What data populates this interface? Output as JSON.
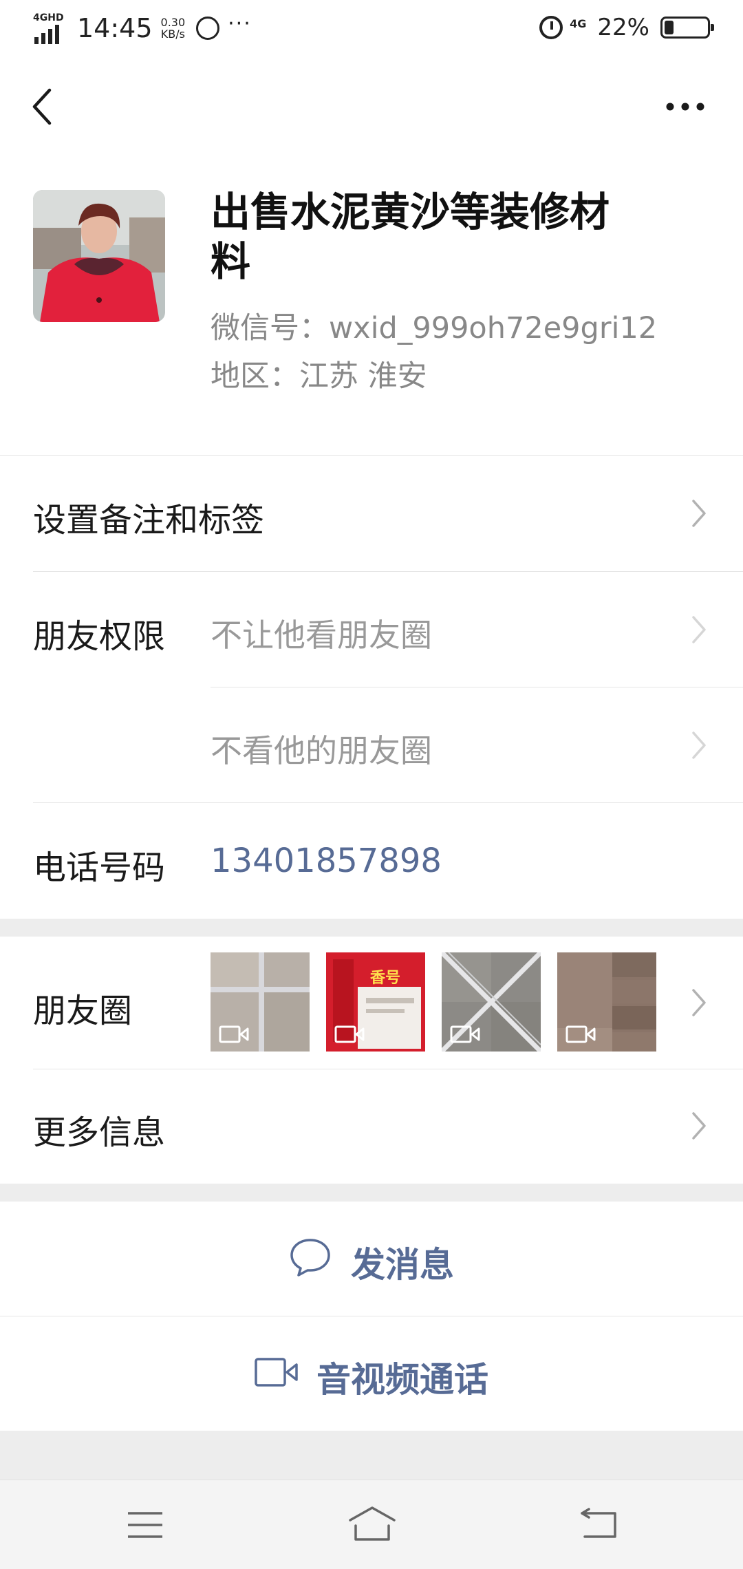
{
  "status_bar": {
    "network": "4GHD",
    "time": "14:45",
    "speed_value": "0.30",
    "speed_unit": "KB/s",
    "more": "···",
    "mobile_data": "4G",
    "battery_percent": "22%",
    "battery_level": 0.22
  },
  "profile": {
    "name": "出售水泥黄沙等装修材料",
    "wechat_id": "微信号：wxid_999oh72e9gri12",
    "region": "地区：江苏  淮安"
  },
  "rows": {
    "remark_label": "设置备注和标签",
    "permissions_label": "朋友权限",
    "permission_1": "不让他看朋友圈",
    "permission_2": "不看他的朋友圈",
    "phone_label": "电话号码",
    "phone_value": "13401857898",
    "moments_label": "朋友圈",
    "more_info_label": "更多信息"
  },
  "moments_thumbnails": [
    {
      "name": "moments-thumb-tiles",
      "has_video": true
    },
    {
      "name": "moments-thumb-bag",
      "has_video": true,
      "text": "香号"
    },
    {
      "name": "moments-thumb-grout",
      "has_video": true
    },
    {
      "name": "moments-thumb-wall",
      "has_video": true
    }
  ],
  "actions": {
    "send_message": "发消息",
    "video_call": "音视频通话"
  },
  "colors": {
    "link": "#576b95",
    "secondary_text": "#888888",
    "divider": "#e5e5e5",
    "section_gap": "#ededed"
  }
}
